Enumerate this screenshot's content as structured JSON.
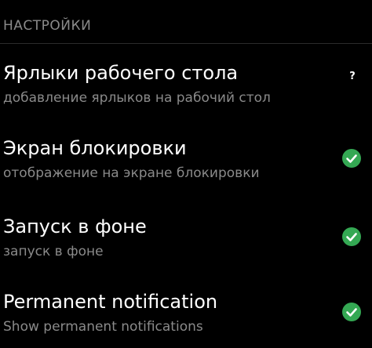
{
  "header": {
    "title": "НАСТРОЙКИ"
  },
  "settings": {
    "items": [
      {
        "title": "Ярлыки рабочего стола",
        "subtitle": "добавление ярлыков на рабочий стол",
        "status_icon": "question-icon",
        "status_text": "?"
      },
      {
        "title": "Экран блокировки",
        "subtitle": "отображение на экране блокировки",
        "status_icon": "check-circle-icon"
      },
      {
        "title": "Запуск в фоне",
        "subtitle": "запуск в фоне",
        "status_icon": "check-circle-icon"
      },
      {
        "title": "Permanent notification",
        "subtitle": "Show permanent notifications",
        "status_icon": "check-circle-icon"
      }
    ]
  },
  "colors": {
    "background": "#000000",
    "primary_text": "#ffffff",
    "secondary_text": "#8a8a8a",
    "check_green": "#34a853"
  }
}
